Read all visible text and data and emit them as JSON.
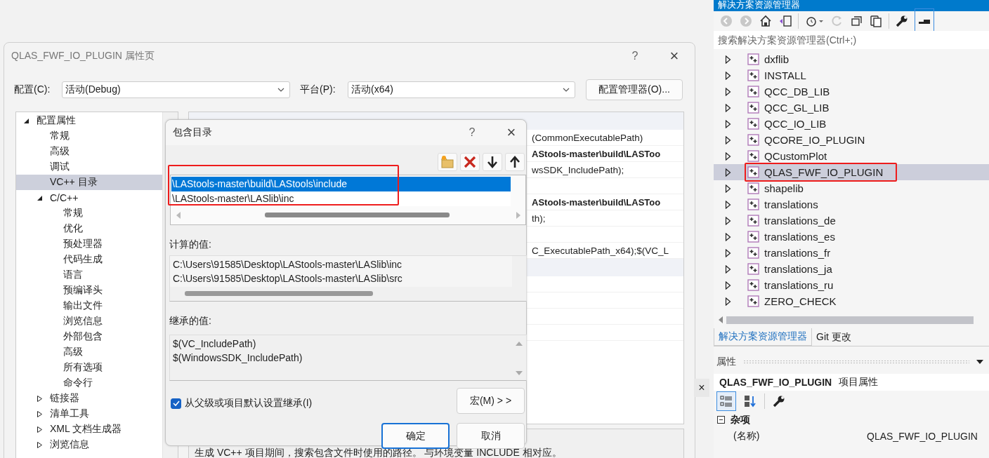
{
  "window": {
    "title": "QLAS_FWF_IO_PLUGIN 属性页",
    "help": "?",
    "close": "×"
  },
  "config_bar": {
    "configuration_label": "配置(C):",
    "configuration": "活动(Debug)",
    "platform_label": "平台(P):",
    "platform": "活动(x64)",
    "manager_button": "配置管理器(O)..."
  },
  "tree": [
    {
      "label": "配置属性",
      "kind": "folder",
      "expanded": true,
      "selected": false,
      "children": [
        {
          "label": "常规",
          "kind": "leaf",
          "selected": false
        },
        {
          "label": "高级",
          "kind": "leaf",
          "selected": false
        },
        {
          "label": "调试",
          "kind": "leaf",
          "selected": false
        },
        {
          "label": "VC++ 目录",
          "kind": "leaf",
          "selected": true
        },
        {
          "label": "C/C++",
          "kind": "folder",
          "expanded": true,
          "selected": false,
          "children": [
            {
              "label": "常规",
              "kind": "leaf",
              "selected": false
            },
            {
              "label": "优化",
              "kind": "leaf",
              "selected": false
            },
            {
              "label": "预处理器",
              "kind": "leaf",
              "selected": false
            },
            {
              "label": "代码生成",
              "kind": "leaf",
              "selected": false
            },
            {
              "label": "语言",
              "kind": "leaf",
              "selected": false
            },
            {
              "label": "预编译头",
              "kind": "leaf",
              "selected": false
            },
            {
              "label": "输出文件",
              "kind": "leaf",
              "selected": false
            },
            {
              "label": "浏览信息",
              "kind": "leaf",
              "selected": false
            },
            {
              "label": "外部包含",
              "kind": "leaf",
              "selected": false
            },
            {
              "label": "高级",
              "kind": "leaf",
              "selected": false
            },
            {
              "label": "所有选项",
              "kind": "leaf",
              "selected": false
            },
            {
              "label": "命令行",
              "kind": "leaf",
              "selected": false
            }
          ]
        },
        {
          "label": "链接器",
          "kind": "folder",
          "expanded": false,
          "selected": false
        },
        {
          "label": "清单工具",
          "kind": "folder",
          "expanded": false,
          "selected": false
        },
        {
          "label": "XML 文档生成器",
          "kind": "folder",
          "expanded": false,
          "selected": false
        },
        {
          "label": "浏览信息",
          "kind": "folder",
          "expanded": false,
          "selected": false
        }
      ]
    }
  ],
  "property_grid": {
    "rows": [
      {
        "kind": "header"
      },
      {
        "kind": "row",
        "value": "(CommonExecutablePath)",
        "bold": false
      },
      {
        "kind": "row",
        "value": "AStools-master\\build\\LASToo",
        "bold": true
      },
      {
        "kind": "row",
        "value": "wsSDK_IncludePath);",
        "bold": false
      },
      {
        "kind": "row"
      },
      {
        "kind": "row",
        "value": "AStools-master\\build\\LASToo",
        "bold": true
      },
      {
        "kind": "row",
        "value": "th);",
        "bold": false
      },
      {
        "kind": "row"
      },
      {
        "kind": "row",
        "value": "C_ExecutablePath_x64);$(VC_L",
        "bold": false
      },
      {
        "kind": "header"
      },
      {
        "kind": "row"
      },
      {
        "kind": "row"
      },
      {
        "kind": "row"
      },
      {
        "kind": "row"
      }
    ]
  },
  "description": "生成 VC++ 项目期间，搜索包含文件时使用的路径。 与环境变量 INCLUDE 相对应。",
  "side_close": "×",
  "include_dialog": {
    "title": "包含目录",
    "help": "?",
    "close": "×",
    "annotation_frame": true,
    "entries": [
      {
        "text": "\\LAStools-master\\build\\LAStools\\include",
        "selected": true
      },
      {
        "text": "\\LAStools-master\\LASlib\\inc",
        "selected": false
      }
    ],
    "evaluated_label": "计算的值:",
    "evaluated_lines": [
      "C:\\Users\\91585\\Desktop\\LAStools-master\\LASlib\\inc",
      "C:\\Users\\91585\\Desktop\\LAStools-master\\LASlib\\src"
    ],
    "inherited_label": "继承的值:",
    "inherited_lines": [
      "$(VC_IncludePath)",
      "$(WindowsSDK_IncludePath)"
    ],
    "inherit_checkbox": {
      "label": "从父级或项目默认设置继承(I)",
      "checked": true
    },
    "macros_button": "宏(M) > >",
    "ok_button": "确定",
    "cancel_button": "取消"
  },
  "solution_explorer": {
    "title": "解决方案资源管理器",
    "search_placeholder": "搜索解决方案资源管理器(Ctrl+;)",
    "items": [
      {
        "label": "dxflib",
        "selected": false,
        "highlighted": false
      },
      {
        "label": "INSTALL",
        "selected": false,
        "highlighted": false
      },
      {
        "label": "QCC_DB_LIB",
        "selected": false,
        "highlighted": false
      },
      {
        "label": "QCC_GL_LIB",
        "selected": false,
        "highlighted": false
      },
      {
        "label": "QCC_IO_LIB",
        "selected": false,
        "highlighted": false
      },
      {
        "label": "QCORE_IO_PLUGIN",
        "selected": false,
        "highlighted": false
      },
      {
        "label": "QCustomPlot",
        "selected": false,
        "highlighted": false
      },
      {
        "label": "QLAS_FWF_IO_PLUGIN",
        "selected": true,
        "highlighted": true
      },
      {
        "label": "shapelib",
        "selected": false,
        "highlighted": false
      },
      {
        "label": "translations",
        "selected": false,
        "highlighted": false
      },
      {
        "label": "translations_de",
        "selected": false,
        "highlighted": false
      },
      {
        "label": "translations_es",
        "selected": false,
        "highlighted": false
      },
      {
        "label": "translations_fr",
        "selected": false,
        "highlighted": false
      },
      {
        "label": "translations_ja",
        "selected": false,
        "highlighted": false
      },
      {
        "label": "translations_ru",
        "selected": false,
        "highlighted": false
      },
      {
        "label": "ZERO_CHECK",
        "selected": false,
        "highlighted": false
      }
    ],
    "tabs": [
      {
        "label": "解决方案资源管理器",
        "selected": true
      },
      {
        "label": "Git 更改",
        "selected": false
      }
    ]
  },
  "properties_panel": {
    "title": "属性",
    "object_name": "QLAS_FWF_IO_PLUGIN",
    "object_type": "项目属性",
    "view_modes": [
      {
        "kind": "categorized",
        "selected": true
      },
      {
        "kind": "alphabetical",
        "selected": false
      }
    ],
    "categories": [
      {
        "label": "杂项",
        "expanded": true,
        "rows": [
          {
            "name": "(名称)",
            "value": "QLAS_FWF_IO_PLUGIN"
          }
        ]
      }
    ]
  }
}
